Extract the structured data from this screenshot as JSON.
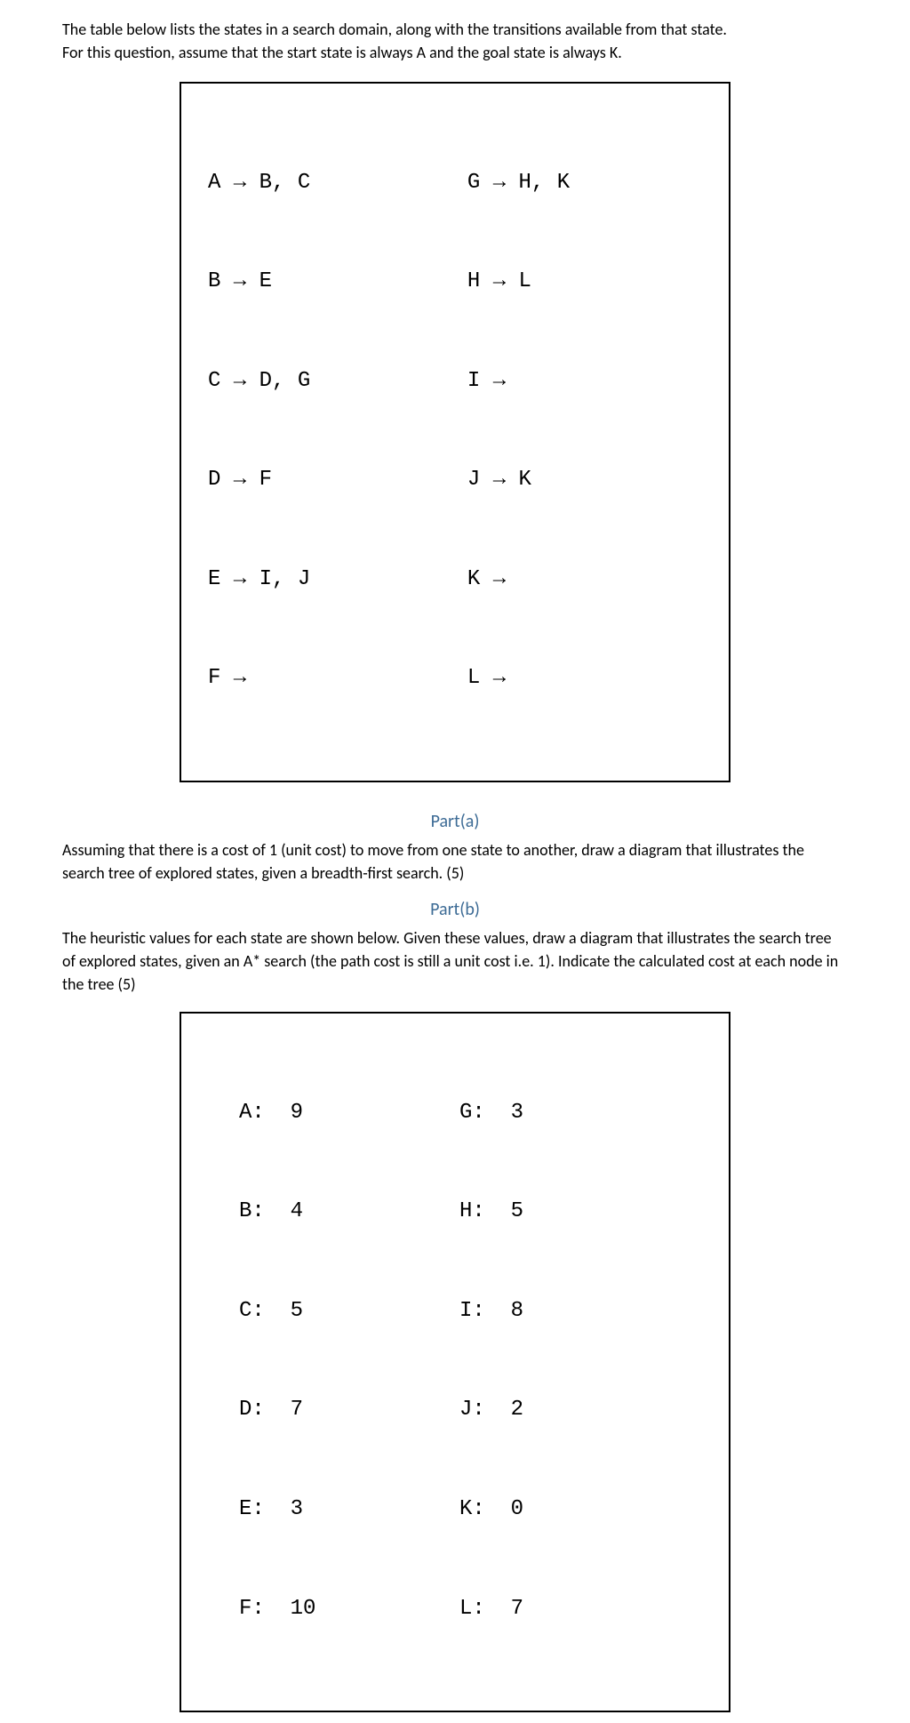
{
  "intro": {
    "line1": "The table below lists the states in a search domain, along with the transitions available from that state.",
    "line2": "For this question, assume that the start state is always A and the goal state is always K."
  },
  "transitions": {
    "left": [
      "A → B, C",
      "B → E",
      "C → D, G",
      "D → F",
      "E → I, J",
      "F →"
    ],
    "right": [
      "G → H, K",
      "H → L",
      "I →",
      "J → K",
      "K →",
      "L →"
    ]
  },
  "partA": {
    "heading": "Part(a)",
    "text": "Assuming that there is a cost of 1 (unit cost) to move from one state to another, draw a diagram that illustrates the search tree of explored states, given a breadth-first search. (5)"
  },
  "partB": {
    "heading": "Part(b)",
    "text": "The heuristic values for each state are shown below. Given these values, draw a diagram that illustrates the search tree of explored states, given an A* search (the path cost is still a unit cost i.e. 1). Indicate the calculated cost at each node in the tree (5)"
  },
  "heuristics": {
    "left": [
      "A:  9",
      "B:  4",
      "C:  5",
      "D:  7",
      "E:  3",
      "F:  10"
    ],
    "right": [
      "G:  3",
      "H:  5",
      "I:  8",
      "J:  2",
      "K:  0",
      "L:  7"
    ]
  },
  "chart_data": {
    "type": "table",
    "transitions": [
      {
        "state": "A",
        "to": [
          "B",
          "C"
        ]
      },
      {
        "state": "B",
        "to": [
          "E"
        ]
      },
      {
        "state": "C",
        "to": [
          "D",
          "G"
        ]
      },
      {
        "state": "D",
        "to": [
          "F"
        ]
      },
      {
        "state": "E",
        "to": [
          "I",
          "J"
        ]
      },
      {
        "state": "F",
        "to": []
      },
      {
        "state": "G",
        "to": [
          "H",
          "K"
        ]
      },
      {
        "state": "H",
        "to": [
          "L"
        ]
      },
      {
        "state": "I",
        "to": []
      },
      {
        "state": "J",
        "to": [
          "K"
        ]
      },
      {
        "state": "K",
        "to": []
      },
      {
        "state": "L",
        "to": []
      }
    ],
    "heuristics": [
      {
        "state": "A",
        "h": 9
      },
      {
        "state": "B",
        "h": 4
      },
      {
        "state": "C",
        "h": 5
      },
      {
        "state": "D",
        "h": 7
      },
      {
        "state": "E",
        "h": 3
      },
      {
        "state": "F",
        "h": 10
      },
      {
        "state": "G",
        "h": 3
      },
      {
        "state": "H",
        "h": 5
      },
      {
        "state": "I",
        "h": 8
      },
      {
        "state": "J",
        "h": 2
      },
      {
        "state": "K",
        "h": 0
      },
      {
        "state": "L",
        "h": 7
      }
    ],
    "start_state": "A",
    "goal_state": "K",
    "unit_cost": 1
  }
}
